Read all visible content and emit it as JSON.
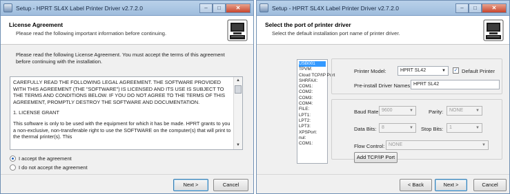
{
  "left": {
    "title": "Setup - HPRT SL4X Label Printer Driver v2.7.2.0",
    "header_title": "License Agreement",
    "header_subtitle": "Please read the following important information before continuing.",
    "intro": "Please read the following License Agreement. You must accept the terms of this agreement before continuing with the installation.",
    "license_p1": "CAREFULLY READ THE FOLLOWING LEGAL AGREEMENT. THE SOFTWARE PROVIDED WITH THIS AGREEMENT (THE \"SOFTWARE\") IS LICENSED AND ITS USE IS SUBJECT TO THE TERMS AND CONDITIONS BELOW. IF YOU DO NOT AGREE TO THE TERMS OF THIS AGREEMENT, PROMPTLY DESTROY THE SOFTWARE AND DOCUMENTATION.",
    "license_p2": "1. LICENSE GRANT",
    "license_p3": "This software is only to be used with the equipment for which it has be made. HPRT grants to you a non-exclusive, non-transferable right to use the SOFTWARE on the computer(s) that will print to the thermal printer(s). This",
    "accept_label": "I accept the agreement",
    "decline_label": "I do not accept the agreement",
    "accept_selected": true,
    "next_label": "Next >",
    "cancel_label": "Cancel"
  },
  "right": {
    "title": "Setup - HPRT SL4X Label Printer Driver v2.7.2.0",
    "header_title": "Select the port of printer driver",
    "header_subtitle": "Select the default installation port name of printer driver.",
    "ports": [
      "USB001",
      "TPVM:",
      "Cloud TCP/IP Port",
      "SHRFAX:",
      "COM1:",
      "COM2:",
      "COM3:",
      "COM4:",
      "FILE:",
      "LPT1:",
      "LPT2:",
      "LPT3:",
      "XPSPort:",
      "nul:",
      "COM1:"
    ],
    "selected_port_index": 0,
    "printer_model_label": "Printer Model:",
    "printer_model_value": "HPRT SL42",
    "default_printer_label": "Default Printer",
    "default_printer_checked": true,
    "preinstall_label": "Pre-install Driver Names:",
    "preinstall_value": "HPRT SL42",
    "baud_rate_label": "Baud Rate:",
    "baud_rate_value": "9600",
    "parity_label": "Parity:",
    "parity_value": "NONE",
    "data_bits_label": "Data Bits:",
    "data_bits_value": "8",
    "stop_bits_label": "Stop Bits:",
    "stop_bits_value": "1",
    "flow_control_label": "Flow Control:",
    "flow_control_value": "NONE",
    "add_port_label": "Add TCP/IP Port",
    "back_label": "< Back",
    "next_label": "Next >",
    "cancel_label": "Cancel"
  },
  "icons": {
    "app": "installer-icon",
    "logo": "computer-setup-icon",
    "close": "close-icon",
    "dropdown": "chevron-down-icon"
  },
  "colors": {
    "titlebar": "#b9d1ea",
    "selection": "#3399ff",
    "close_button": "#c8452d"
  }
}
